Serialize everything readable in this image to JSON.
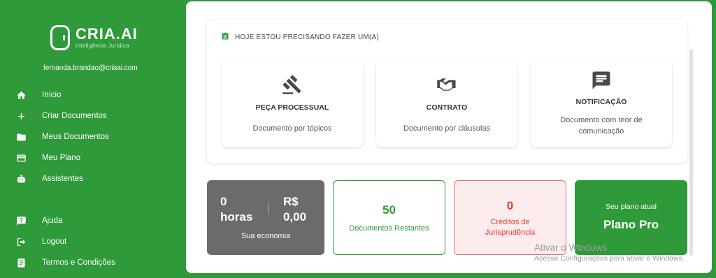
{
  "brand": {
    "name": "CRIA.AI",
    "tagline": "Inteligência Jurídica",
    "primary_color": "#2e9a3a"
  },
  "user": {
    "email": "fernanda.brandao@criaai.com"
  },
  "sidebar": {
    "items": [
      {
        "label": "Início",
        "icon": "home-icon"
      },
      {
        "label": "Criar Documentos",
        "icon": "plus-icon"
      },
      {
        "label": "Meus Documentos",
        "icon": "folder-icon"
      },
      {
        "label": "Meu Plano",
        "icon": "card-icon"
      },
      {
        "label": "Assistentes",
        "icon": "robot-icon"
      }
    ],
    "bottom_items": [
      {
        "label": "Ajuda",
        "icon": "help-icon"
      },
      {
        "label": "Logout",
        "icon": "logout-icon"
      },
      {
        "label": "Termos e Condições",
        "icon": "document-icon"
      }
    ]
  },
  "task": {
    "title": "HOJE ESTOU PRECISANDO FAZER UM(A)",
    "options": [
      {
        "title": "PEÇA PROCESSUAL",
        "description": "Documento por tópicos",
        "icon": "gavel-icon"
      },
      {
        "title": "CONTRATO",
        "description": "Documento por cláusulas",
        "icon": "handshake-icon"
      },
      {
        "title": "NOTIFICAÇÃO",
        "description": "Documento com teor de comunicação",
        "icon": "message-icon"
      }
    ]
  },
  "stats": {
    "economy": {
      "hours_value": "0",
      "hours_unit": "horas",
      "currency": "R$",
      "money_value": "0,00",
      "label": "Sua economia"
    },
    "documents": {
      "value": "50",
      "label": "Documentos Restantes"
    },
    "credits": {
      "value": "0",
      "label": "Créditos de Jurisprudência"
    },
    "plan": {
      "label": "Seu plano atual",
      "name": "Plano Pro"
    }
  },
  "watermark": {
    "title": "Ativar o Windows",
    "subtitle": "Acesse Configurações para ativar o Windows."
  }
}
